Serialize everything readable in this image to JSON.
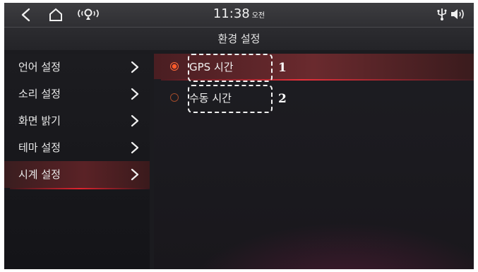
{
  "status_bar": {
    "time": "11:38",
    "ampm": "오전"
  },
  "title": "환경 설정",
  "sidebar": {
    "items": [
      {
        "label": "언어 설정",
        "icon": "chevron-right-icon"
      },
      {
        "label": "소리 설정",
        "icon": "chevron-right-icon"
      },
      {
        "label": "화면 밝기",
        "icon": "chevron-right-icon"
      },
      {
        "label": "테마 설정",
        "icon": "chevron-right-icon"
      },
      {
        "label": "시계 설정",
        "icon": "chevron-right-icon",
        "active": true
      }
    ]
  },
  "options": [
    {
      "label": "GPS 시간",
      "selected": true,
      "callout": "1"
    },
    {
      "label": "수동 시간",
      "selected": false,
      "callout": "2"
    }
  ],
  "colors": {
    "accent_red": "#e0232e",
    "radio_on": "#ff5a2a",
    "background": "#1b1b1f"
  }
}
